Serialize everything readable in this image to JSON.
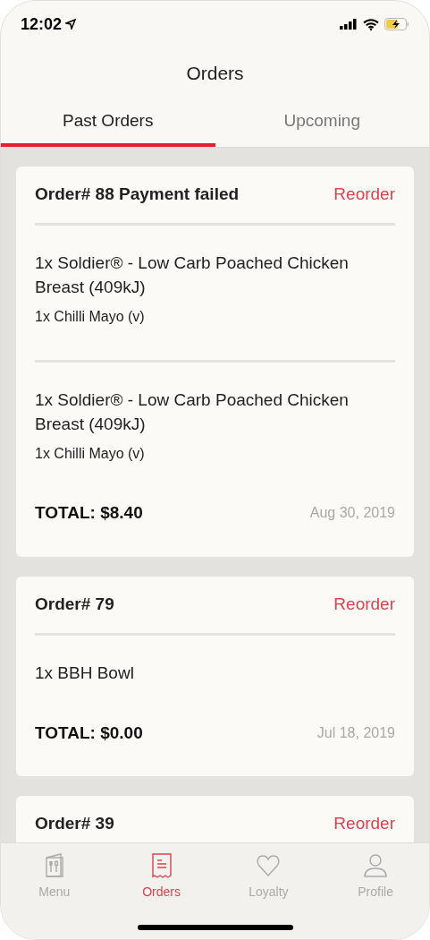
{
  "status_bar": {
    "time": "12:02"
  },
  "title": "Orders",
  "tabs": [
    {
      "label": "Past Orders",
      "selected": true
    },
    {
      "label": "Upcoming",
      "selected": false
    }
  ],
  "orders": [
    {
      "title": "Order# 88 Payment failed",
      "action": "Reorder",
      "items": [
        {
          "name": "1x Soldier® - Low Carb Poached Chicken Breast (409kJ)",
          "modifier": "1x Chilli Mayo (v)"
        },
        {
          "name": "1x Soldier® - Low Carb Poached Chicken Breast (409kJ)",
          "modifier": "1x Chilli Mayo (v)"
        }
      ],
      "total": "TOTAL: $8.40",
      "date": "Aug 30, 2019"
    },
    {
      "title": "Order# 79",
      "action": "Reorder",
      "items": [
        {
          "name": "1x BBH Bowl"
        }
      ],
      "total": "TOTAL: $0.00",
      "date": "Jul 18, 2019"
    },
    {
      "title": "Order# 39",
      "action": "Reorder"
    }
  ],
  "nav": [
    {
      "kind": "menu",
      "label": "Menu",
      "selected": false
    },
    {
      "kind": "orders",
      "label": "Orders",
      "selected": true
    },
    {
      "kind": "loyalty",
      "label": "Loyalty",
      "selected": false
    },
    {
      "kind": "profile",
      "label": "Profile",
      "selected": false
    }
  ]
}
